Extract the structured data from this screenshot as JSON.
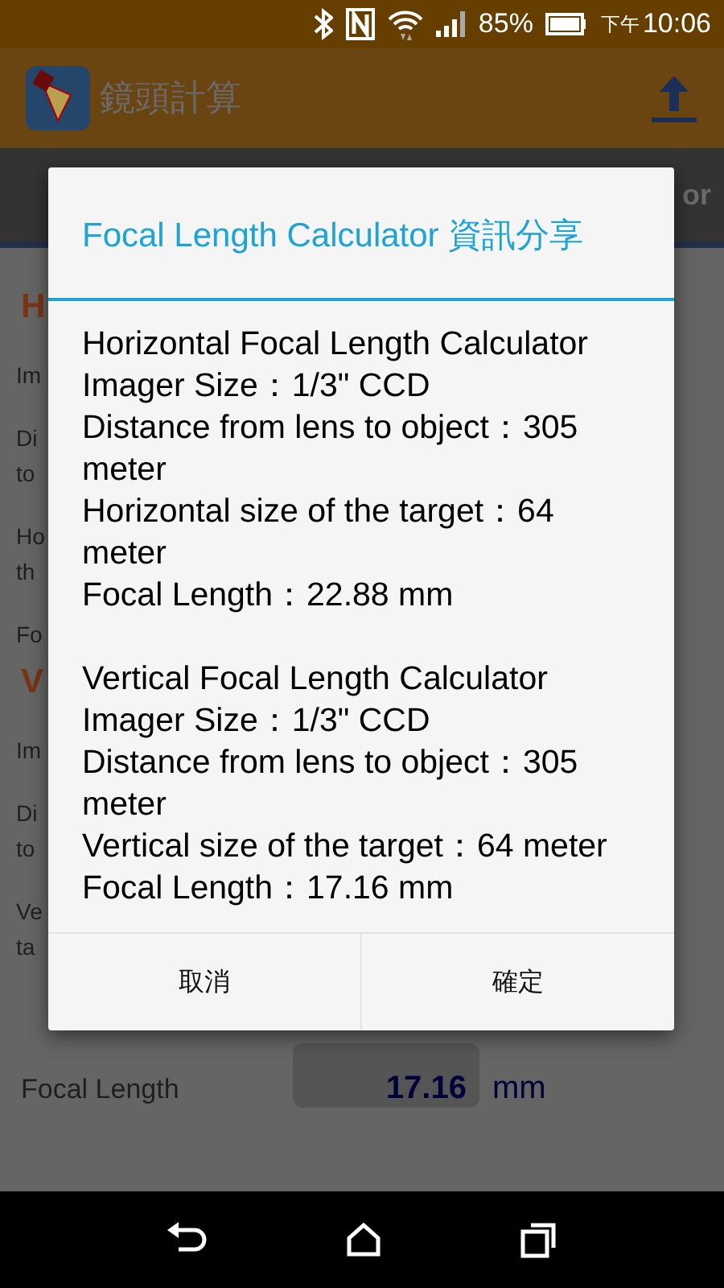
{
  "status_bar": {
    "battery_text": "85%",
    "time_prefix": "下午",
    "time": "10:06"
  },
  "app_bar": {
    "title": "鏡頭計算"
  },
  "tabs": [
    {
      "label": "or"
    }
  ],
  "background_rows": [
    {
      "kind": "heading",
      "text": "H"
    },
    {
      "kind": "label",
      "text": "Im"
    },
    {
      "kind": "label",
      "text": "Di"
    },
    {
      "kind": "cont",
      "text": "to"
    },
    {
      "kind": "label",
      "text": "Ho"
    },
    {
      "kind": "cont",
      "text": "th"
    },
    {
      "kind": "label",
      "text": "Fo"
    },
    {
      "kind": "heading",
      "text": "V"
    },
    {
      "kind": "label",
      "text": "Im"
    },
    {
      "kind": "label",
      "text": "Di"
    },
    {
      "kind": "cont",
      "text": "to"
    },
    {
      "kind": "label",
      "text": "Ve"
    },
    {
      "kind": "cont",
      "text": "ta"
    },
    {
      "kind": "result",
      "text": "Focal Length",
      "value": "17.16",
      "unit": "mm"
    }
  ],
  "dialog": {
    "title": "Focal Length Calculator 資訊分享",
    "lines": [
      {
        "kind": "heading",
        "text": "Horizontal Focal Length Calculator"
      },
      {
        "kind": "line",
        "text": "Imager Size：1/3\" CCD"
      },
      {
        "kind": "line",
        "text": "Distance from lens to object：305 meter"
      },
      {
        "kind": "line",
        "text": "Horizontal size of the target：64 meter"
      },
      {
        "kind": "line",
        "text": "Focal Length：22.88 mm"
      },
      {
        "kind": "heading",
        "text": "Vertical Focal Length Calculator"
      },
      {
        "kind": "line",
        "text": "Imager Size：1/3\" CCD"
      },
      {
        "kind": "line",
        "text": "Distance from lens to object：305 meter"
      },
      {
        "kind": "line",
        "text": "Vertical size of the target：64 meter"
      },
      {
        "kind": "line",
        "text": "Focal Length：17.16 mm"
      }
    ],
    "buttons": [
      "取消",
      "確定"
    ]
  }
}
